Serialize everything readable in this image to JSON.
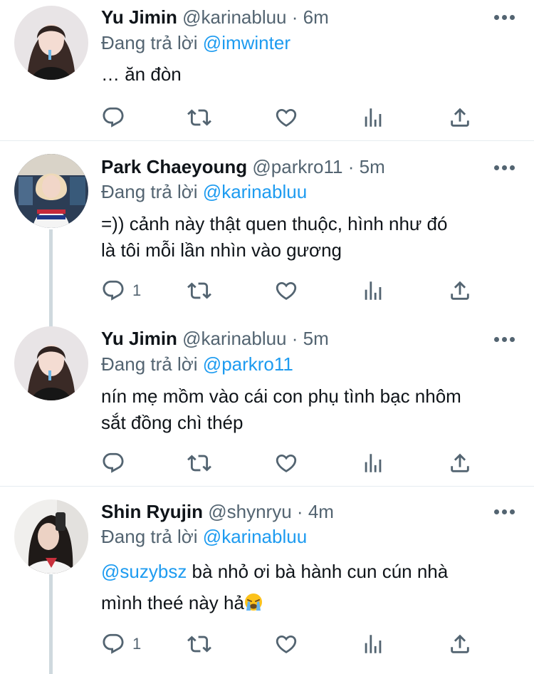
{
  "reply_prefix": "Đang trả lời",
  "colors": {
    "accent": "#1d9bf0",
    "secondary": "#536471",
    "text": "#0f1419"
  },
  "tweets": [
    {
      "name": "Yu Jimin",
      "handle": "@karinabluu",
      "dot": "·",
      "time": "6m",
      "reply_to": "@imwinter",
      "text": "… ăn đòn",
      "reply_count": ""
    },
    {
      "name": "Park Chaeyoung",
      "handle": "@parkro11",
      "dot": "·",
      "time": "5m",
      "reply_to": "@karinabluu",
      "text_line1": "=)) cảnh này thật quen thuộc, hình như đó",
      "text_line2": "là tôi mỗi lần nhìn vào gương",
      "reply_count": "1"
    },
    {
      "name": "Yu Jimin",
      "handle": "@karinabluu",
      "dot": "·",
      "time": "5m",
      "reply_to": "@parkro11",
      "text_line1": "nín mẹ mồm vào cái con phụ tình bạc nhôm",
      "text_line2": "sắt đồng chì thép",
      "reply_count": ""
    },
    {
      "name": "Shin Ryujin",
      "handle": "@shynryu",
      "dot": "·",
      "time": "4m",
      "reply_to": "@karinabluu",
      "mention": "@suzybsz",
      "text_line1_rest": " bà nhỏ ơi bà hành cun cún nhà",
      "text_line2": "mình theé này hả",
      "emoji": "loudly-crying-face-emoji",
      "reply_count": "1"
    }
  ],
  "icons": {
    "reply": "reply-icon",
    "retweet": "retweet-icon",
    "like": "like-icon",
    "analytics": "analytics-icon",
    "share": "share-icon",
    "more": "more-icon"
  }
}
